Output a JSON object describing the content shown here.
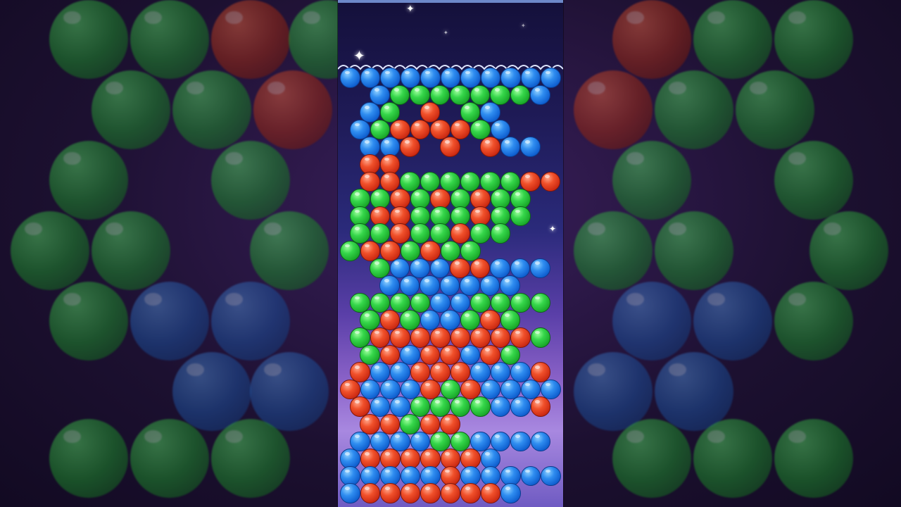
{
  "game": {
    "colors": {
      "blue": "#1f78e6",
      "green": "#2cc23e",
      "red": "#e03d1c",
      "accent": "#6d88c9"
    },
    "grid_rows": [
      "bbbbbbbbbbb",
      "bgggggggb",
      "bg_r_gb",
      "bgrrrrgb",
      "bbr_r_rbb",
      "rr",
      "rrggggggrr",
      "ggrgrgrgg",
      "grrgggrgg",
      "ggrggrgg",
      "grrgrgg",
      "gbbbrrbbbg",
      "bbbbbbb",
      "ggggbbggggg",
      "grgbbgrg",
      "grrrrrrrrg",
      "grbrrbrg",
      "rbbrrrbbbr",
      "rbbbrgrbbbbr",
      "rbbggggbbr",
      "rrgrr",
      "bbbbggbbbbb",
      "brrrrrrb",
      "bbbbbrbbbbb",
      "brrrrrrrb"
    ],
    "icons": [
      "star-icon",
      "sparkle-icon"
    ]
  }
}
